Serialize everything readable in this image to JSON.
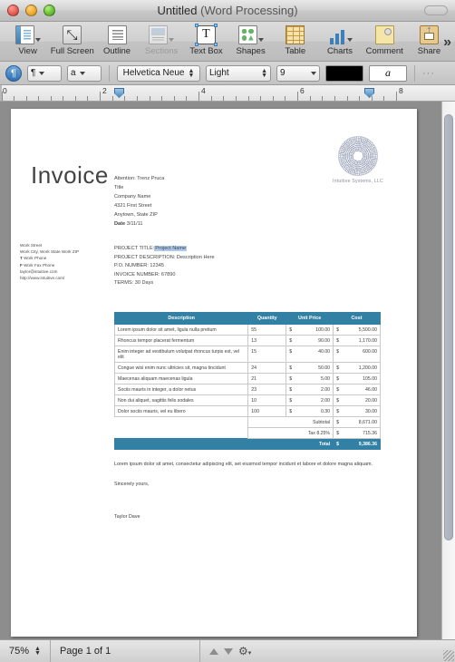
{
  "window": {
    "title": "Untitled",
    "subtitle": "(Word Processing)"
  },
  "toolbar": {
    "items": [
      {
        "label": "View",
        "icon": "view-icon",
        "has_caret": true,
        "disabled": false
      },
      {
        "label": "Full Screen",
        "icon": "full-screen-icon",
        "has_caret": false,
        "disabled": false
      },
      {
        "label": "Outline",
        "icon": "outline-icon",
        "has_caret": false,
        "disabled": false
      },
      {
        "label": "Sections",
        "icon": "sections-icon",
        "has_caret": true,
        "disabled": true
      },
      {
        "label": "Text Box",
        "icon": "text-box-icon",
        "has_caret": false,
        "disabled": false
      },
      {
        "label": "Shapes",
        "icon": "shapes-icon",
        "has_caret": true,
        "disabled": false
      },
      {
        "label": "Table",
        "icon": "table-icon",
        "has_caret": false,
        "disabled": false
      },
      {
        "label": "Charts",
        "icon": "charts-icon",
        "has_caret": true,
        "disabled": false
      },
      {
        "label": "Comment",
        "icon": "comment-icon",
        "has_caret": false,
        "disabled": false
      },
      {
        "label": "Share",
        "icon": "share-icon",
        "has_caret": false,
        "disabled": false
      }
    ],
    "overflow_label": "»"
  },
  "format_bar": {
    "paragraph_mark": "¶",
    "style_button": "¶",
    "char_style_button": "a",
    "font_family": "Helvetica Neue",
    "font_style": "Light",
    "font_size": "9",
    "text_color": "#000000",
    "highlight_glyph": "a",
    "dots": "···"
  },
  "ruler": {
    "labels": [
      "0",
      "2",
      "4",
      "6",
      "8"
    ],
    "left_indent_position": "0.75in",
    "right_indent_position": "7.0in"
  },
  "document": {
    "logo": {
      "icon": "radial-spiral-logo",
      "caption": "Intuitive Systems, LLC"
    },
    "title": "Invoice",
    "address": [
      "Attention: Trenz Pruca",
      "Title",
      "Company Name",
      "4321 First Street",
      "Anytown, State ZIP"
    ],
    "date_label": "Date",
    "date_value": "3/11/11",
    "worksheet": [
      "Work Street",
      "Work City, Work State Work ZIP",
      "Work Phone",
      "Work Fax Phone",
      "taylor@intuitive.com",
      "http://www.intuitive.com/"
    ],
    "worksheet_prefixes": [
      "",
      "",
      "T",
      "F",
      "",
      ""
    ],
    "project": {
      "title_label": "PROJECT TITLE:",
      "title_value": "Project Name",
      "description_label": "PROJECT DESCRIPTION:",
      "description_value": "Description Here",
      "po_label": "P.O. NUMBER:",
      "po_value": "12345",
      "invoice_label": "INVOICE NUMBER:",
      "invoice_value": "67890",
      "terms_label": "TERMS:",
      "terms_value": "30 Days"
    },
    "table": {
      "headers": [
        "Description",
        "Quantity",
        "Unit Price",
        "Cost"
      ],
      "rows": [
        {
          "description": "Lorem ipsum dolor sit amet, ligula nulla pretium",
          "quantity": "55",
          "unit_price": "100.00",
          "cost": "5,500.00"
        },
        {
          "description": "Rhoncus tempor placerat fermentum",
          "quantity": "13",
          "unit_price": "90.00",
          "cost": "1,170.00"
        },
        {
          "description": "Enim integer ad vestibulum volutpat rhoncus turpis est, vel elit",
          "quantity": "15",
          "unit_price": "40.00",
          "cost": "600.00"
        },
        {
          "description": "Congue wisi enim nunc ultricies sit, magna tincidunt",
          "quantity": "24",
          "unit_price": "50.00",
          "cost": "1,200.00"
        },
        {
          "description": "Maecenas aliquam maecenas ligula",
          "quantity": "21",
          "unit_price": "5.00",
          "cost": "105.00"
        },
        {
          "description": "Sociis mauris in integer, a dolor netus",
          "quantity": "23",
          "unit_price": "2.00",
          "cost": "46.00"
        },
        {
          "description": "Non dui aliquet, sagittis felis sodales",
          "quantity": "10",
          "unit_price": "2.00",
          "cost": "20.00"
        },
        {
          "description": "Dolor sociis mauris, vel eu libero",
          "quantity": "100",
          "unit_price": "0.30",
          "cost": "30.00"
        }
      ],
      "subtotal_label": "Subtotal",
      "subtotal_value": "8,671.00",
      "tax_label": "Tax 8.25%",
      "tax_value": "715.36",
      "total_label": "Total",
      "total_value": "9,386.36",
      "header_color": "#3281a4"
    },
    "closing": {
      "paragraph": "Lorem ipsum dolor sit amet, consectetur adipiscing elit, set eiusmod tempor incidunt et labore et dolore magna aliquam.",
      "sign_off": "Sincerely yours,",
      "signer": "Taylor Dave"
    }
  },
  "status_bar": {
    "zoom": "75%",
    "page_indicator": "Page 1 of 1",
    "prev_page_icon": "triangle-up-icon",
    "next_page_icon": "triangle-down-icon",
    "settings_icon": "gear-icon"
  }
}
